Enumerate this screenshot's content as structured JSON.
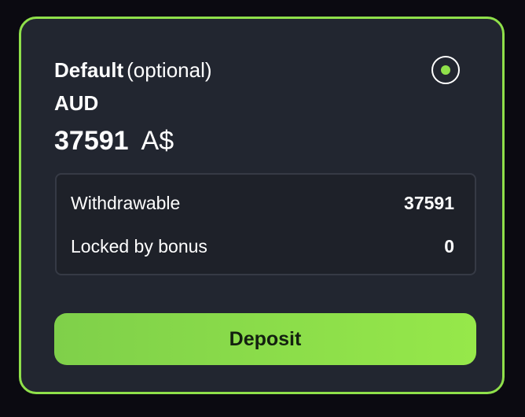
{
  "account": {
    "title": "Default",
    "title_suffix": "(optional)",
    "selected": true,
    "currency_code": "AUD",
    "balance": "37591",
    "currency_symbol": "A$"
  },
  "breakdown": {
    "rows": [
      {
        "label": "Withdrawable",
        "value": "37591"
      },
      {
        "label": "Locked by bonus",
        "value": "0"
      }
    ]
  },
  "actions": {
    "deposit_label": "Deposit"
  },
  "colors": {
    "accent": "#8fe04a",
    "card_background": "#222630",
    "page_background": "#0b0a11"
  }
}
